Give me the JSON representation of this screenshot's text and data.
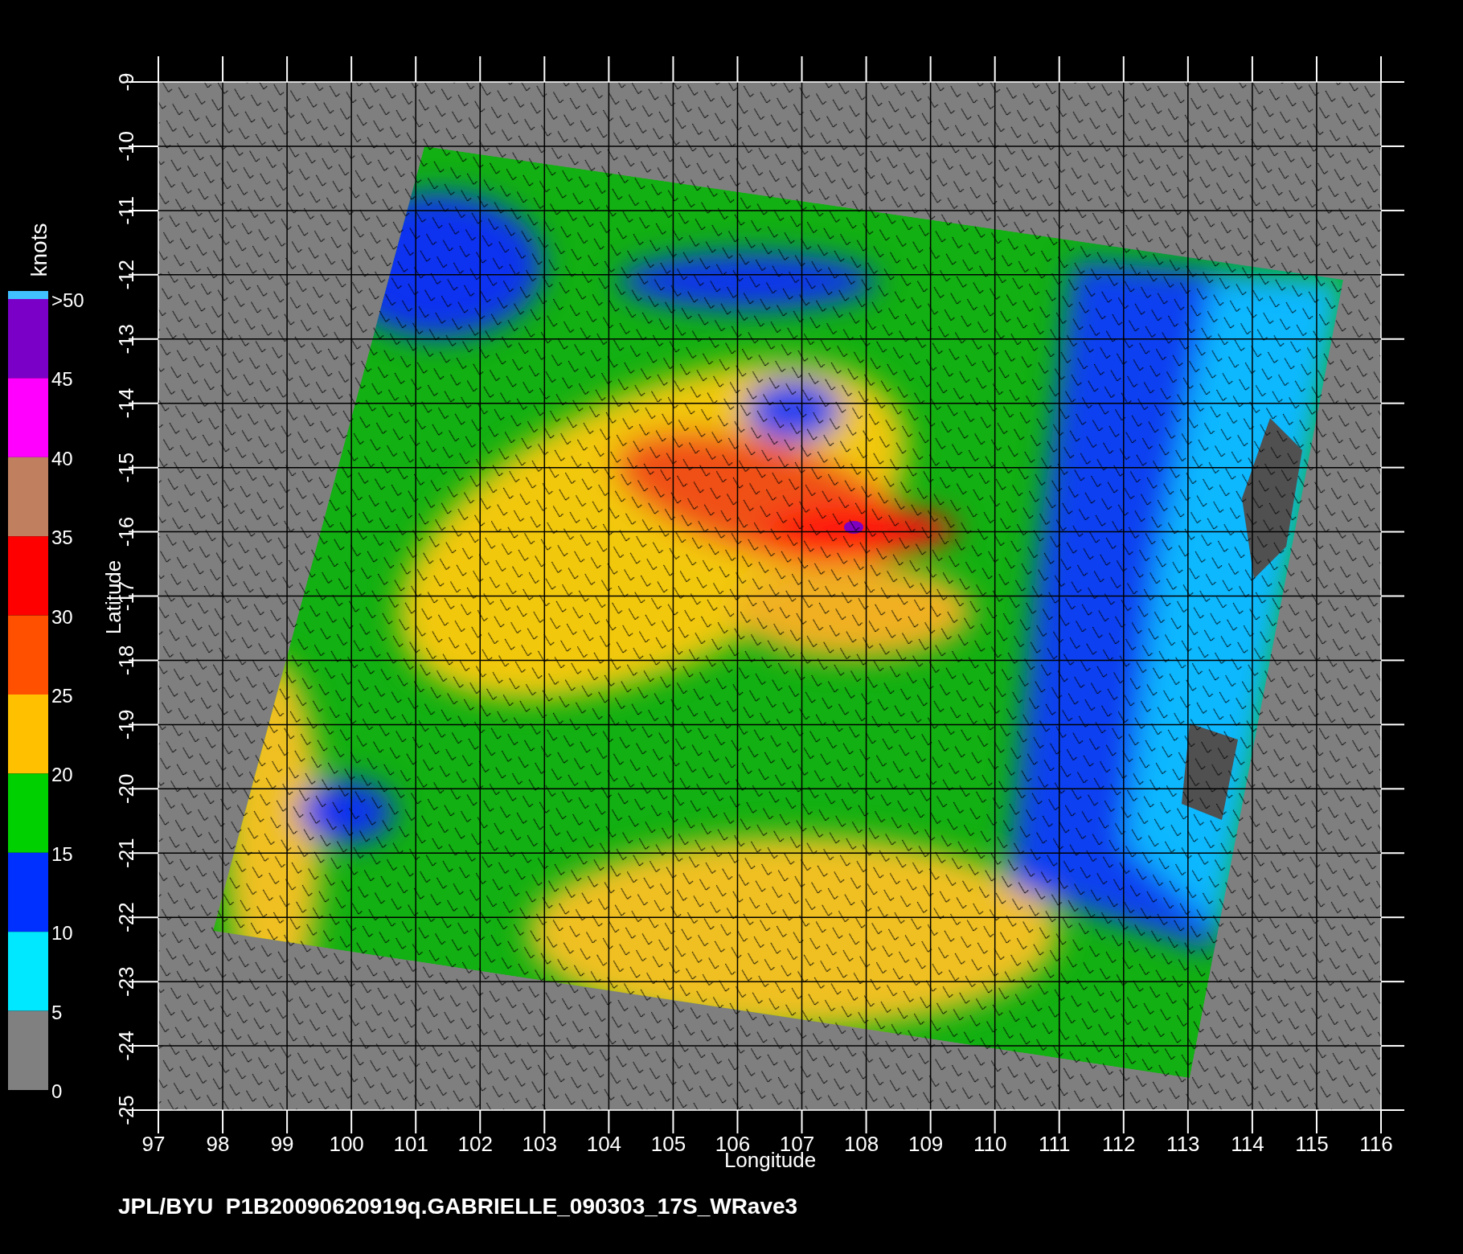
{
  "plot": {
    "xlabel": "Longitude",
    "ylabel": "Latitude",
    "xticks": [
      "97",
      "98",
      "99",
      "100",
      "101",
      "102",
      "103",
      "104",
      "105",
      "106",
      "107",
      "108",
      "109",
      "110",
      "111",
      "112",
      "113",
      "114",
      "115",
      "116"
    ],
    "yticks": [
      "-9",
      "-10",
      "-11",
      "-12",
      "-13",
      "-14",
      "-15",
      "-16",
      "-17",
      "-18",
      "-19",
      "-20",
      "-21",
      "-22",
      "-23",
      "-24",
      "-25"
    ]
  },
  "colorbar": {
    "title": "knots",
    "labels": [
      ">50",
      "45",
      "40",
      "35",
      "30",
      "25",
      "20",
      "15",
      "10",
      "5",
      "0"
    ],
    "bands": [
      {
        "color": "#7a00c8"
      },
      {
        "color": "#ff00ff"
      },
      {
        "color": "#c08060"
      },
      {
        "color": "#ff0000"
      },
      {
        "color": "#ff5000"
      },
      {
        "color": "#ffc000"
      },
      {
        "color": "#00d000"
      },
      {
        "color": "#0030ff"
      },
      {
        "color": "#00e8ff"
      },
      {
        "color": "#808080"
      }
    ]
  },
  "footer": "JPL/BYU  P1B20090620919q.GABRIELLE_090303_17S_WRave3"
}
